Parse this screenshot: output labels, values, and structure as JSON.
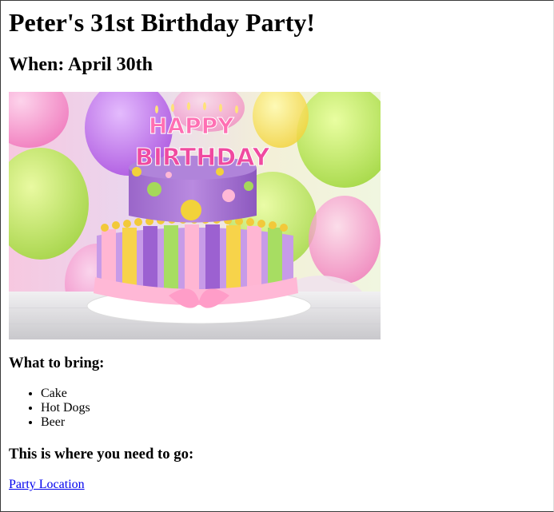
{
  "page": {
    "title": "Peter's 31st Birthday Party!",
    "when": "When: April 30th"
  },
  "image": {
    "semantic": "birthday-cake-photo",
    "cake_text_line1": "HAPPY",
    "cake_text_line2": "BIRTHDAY"
  },
  "bring": {
    "heading": "What to bring:",
    "items": [
      "Cake",
      "Hot Dogs",
      "Beer"
    ]
  },
  "directions": {
    "heading": "This is where you need to go:",
    "link_label": "Party Location"
  },
  "colors": {
    "link": "#0000ee",
    "text": "#000000"
  }
}
